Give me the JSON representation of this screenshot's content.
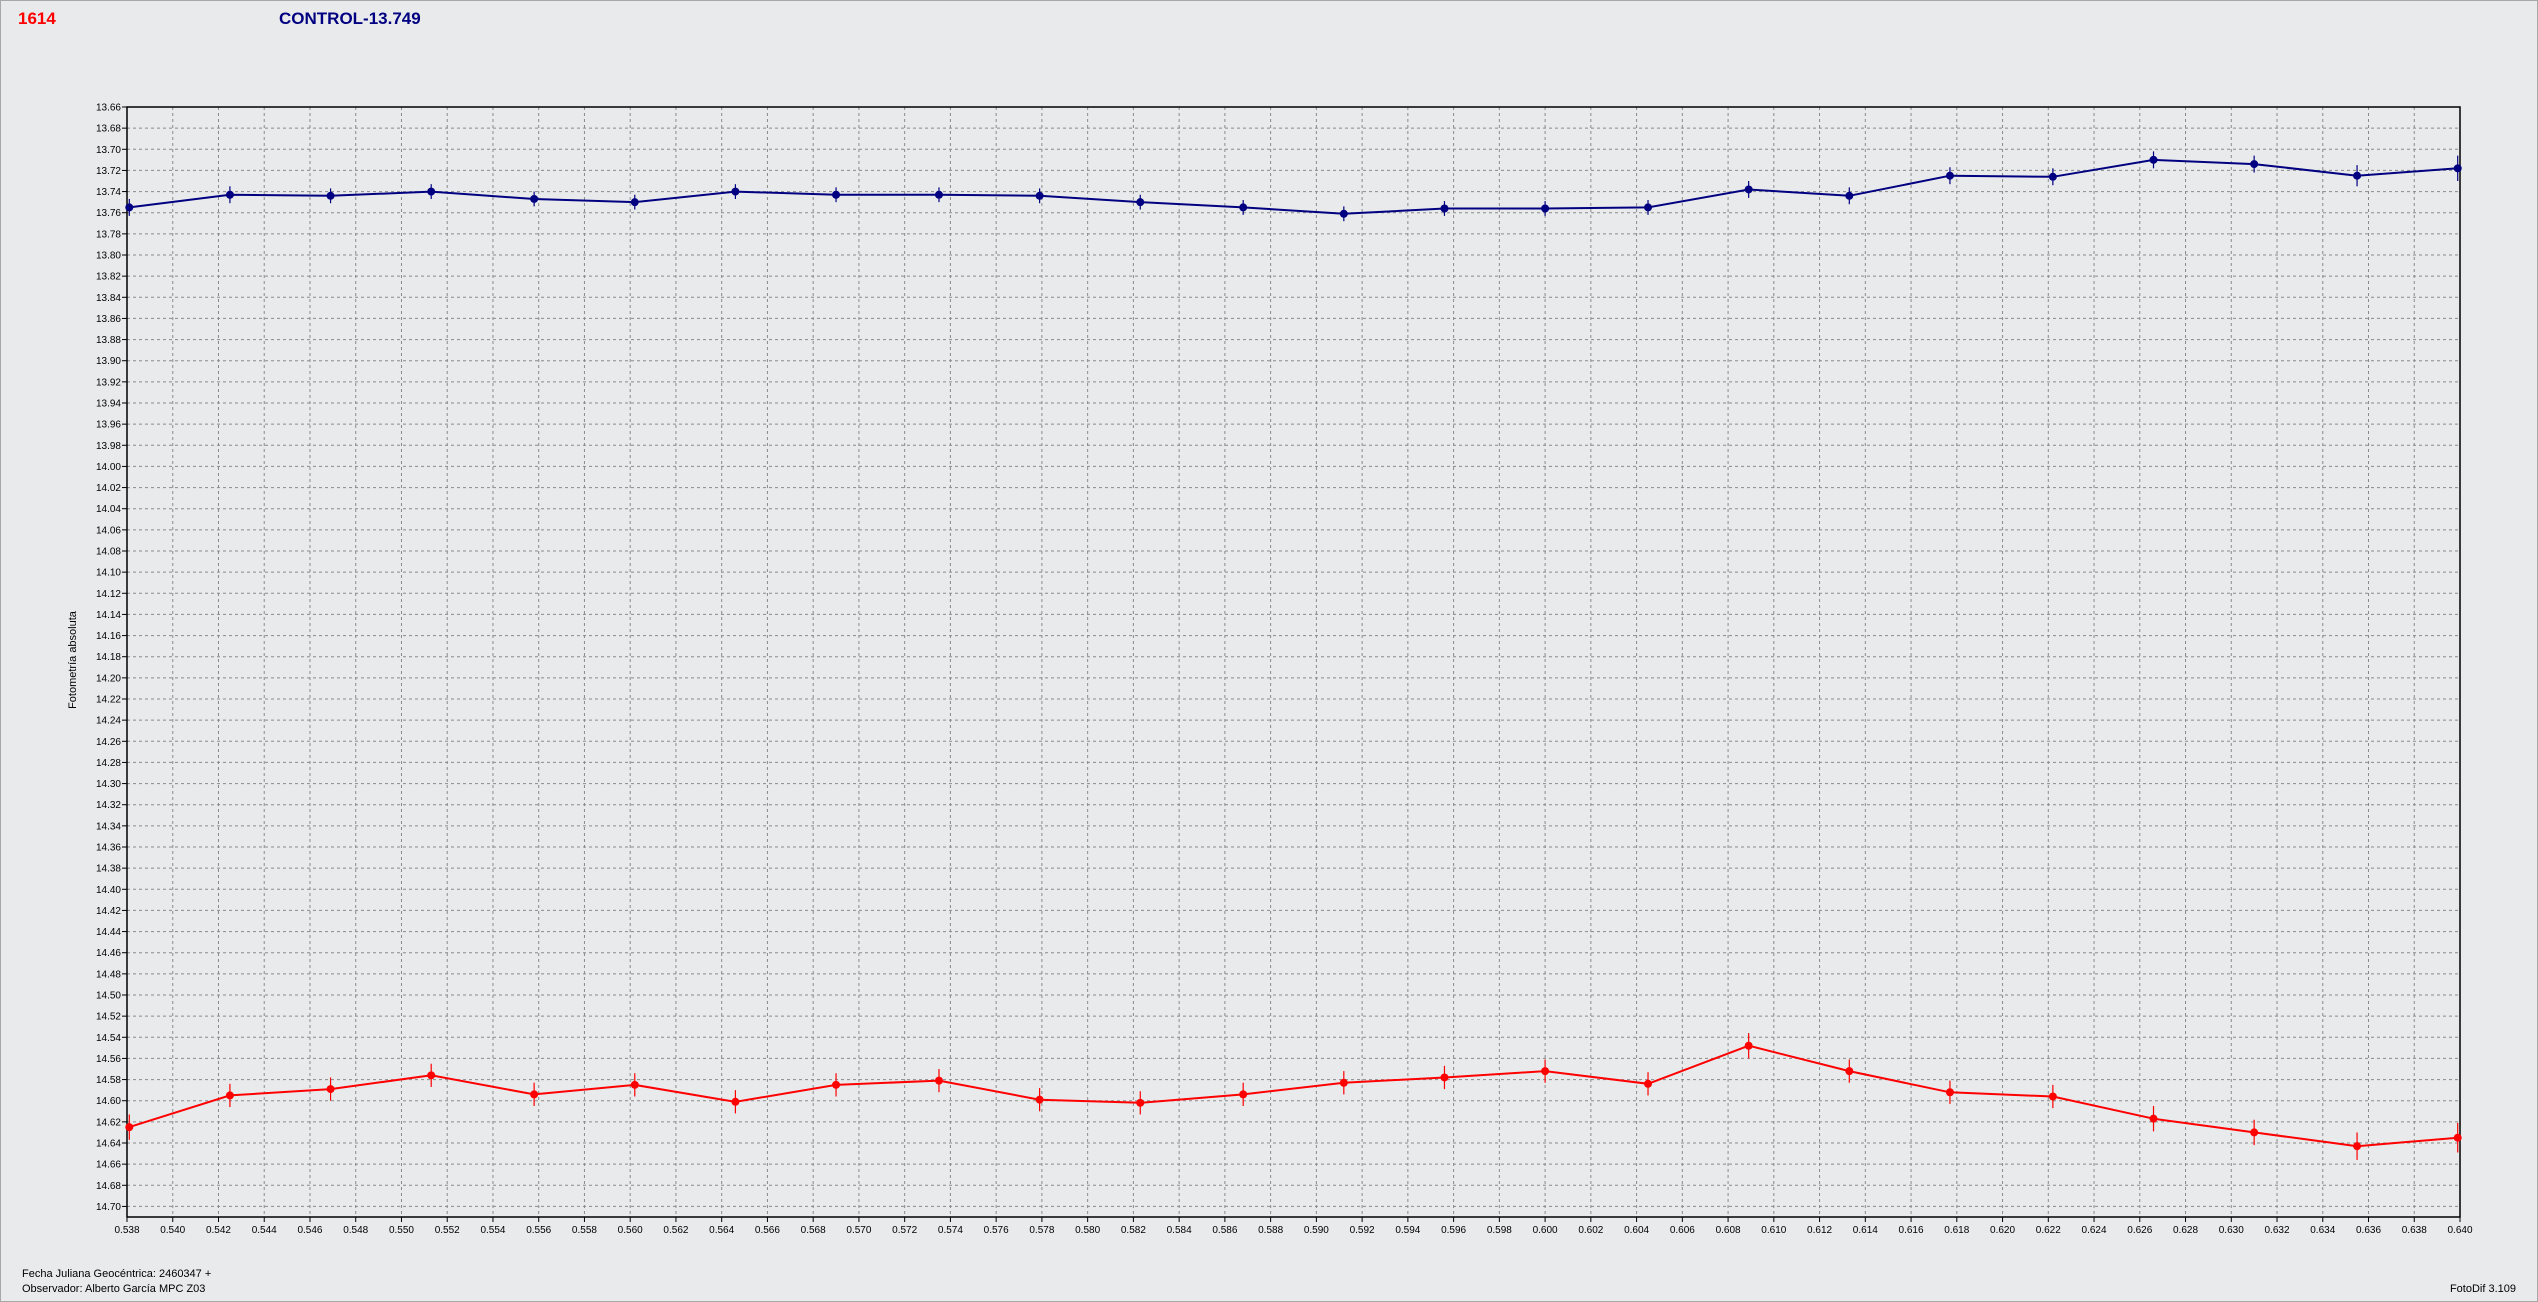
{
  "header": {
    "object_id": "1614",
    "control_label": "CONTROL-13.749"
  },
  "footer": {
    "jd_label": "Fecha Juliana Geocéntrica: 2460347 +",
    "observer_label": "Observador: Alberto García MPC Z03",
    "software_version": "FotoDif 3.109"
  },
  "chart_data": {
    "type": "line",
    "title": "",
    "xlabel": "",
    "ylabel": "Fotometría absoluta",
    "xlim": [
      0.538,
      0.64
    ],
    "ylim": [
      13.66,
      14.71
    ],
    "y_inverted": true,
    "grid": true,
    "x_ticks": [
      "0.538",
      "0.540",
      "0.542",
      "0.544",
      "0.546",
      "0.548",
      "0.550",
      "0.552",
      "0.554",
      "0.556",
      "0.558",
      "0.560",
      "0.562",
      "0.564",
      "0.566",
      "0.568",
      "0.570",
      "0.572",
      "0.574",
      "0.576",
      "0.578",
      "0.580",
      "0.582",
      "0.584",
      "0.586",
      "0.588",
      "0.590",
      "0.592",
      "0.594",
      "0.596",
      "0.598",
      "0.600",
      "0.602",
      "0.604",
      "0.606",
      "0.608",
      "0.610",
      "0.612",
      "0.614",
      "0.616",
      "0.618",
      "0.620",
      "0.622",
      "0.624",
      "0.626",
      "0.628",
      "0.630",
      "0.632",
      "0.634",
      "0.636",
      "0.638",
      "0.640"
    ],
    "y_ticks": [
      "13.66",
      "13.68",
      "13.70",
      "13.72",
      "13.74",
      "13.76",
      "13.78",
      "13.80",
      "13.82",
      "13.84",
      "13.86",
      "13.88",
      "13.90",
      "13.92",
      "13.94",
      "13.96",
      "13.98",
      "14.00",
      "14.02",
      "14.04",
      "14.06",
      "14.08",
      "14.10",
      "14.12",
      "14.14",
      "14.16",
      "14.18",
      "14.20",
      "14.22",
      "14.24",
      "14.26",
      "14.28",
      "14.30",
      "14.32",
      "14.34",
      "14.36",
      "14.38",
      "14.40",
      "14.42",
      "14.44",
      "14.46",
      "14.48",
      "14.50",
      "14.52",
      "14.54",
      "14.56",
      "14.58",
      "14.60",
      "14.62",
      "14.64",
      "14.66",
      "14.68",
      "14.70"
    ],
    "x": [
      0.5381,
      0.5425,
      0.5469,
      0.5513,
      0.5558,
      0.5602,
      0.5646,
      0.569,
      0.5735,
      0.5779,
      0.5823,
      0.5868,
      0.5912,
      0.5956,
      0.6,
      0.6045,
      0.6089,
      0.6133,
      0.6177,
      0.6222,
      0.6266,
      0.631,
      0.6355,
      0.6399
    ],
    "series": [
      {
        "color": "#000080",
        "values": [
          13.755,
          13.743,
          13.744,
          13.74,
          13.747,
          13.75,
          13.74,
          13.743,
          13.743,
          13.744,
          13.75,
          13.755,
          13.761,
          13.756,
          13.756,
          13.755,
          13.738,
          13.744,
          13.725,
          13.726,
          13.71,
          13.714,
          13.725,
          13.718
        ],
        "errors": [
          0.008,
          0.008,
          0.007,
          0.007,
          0.007,
          0.007,
          0.007,
          0.007,
          0.007,
          0.007,
          0.007,
          0.007,
          0.007,
          0.007,
          0.007,
          0.007,
          0.008,
          0.008,
          0.008,
          0.008,
          0.008,
          0.008,
          0.01,
          0.012
        ]
      },
      {
        "color": "#ff0000",
        "values": [
          14.625,
          14.595,
          14.589,
          14.576,
          14.594,
          14.585,
          14.601,
          14.585,
          14.581,
          14.599,
          14.602,
          14.594,
          14.583,
          14.578,
          14.572,
          14.584,
          14.548,
          14.572,
          14.592,
          14.596,
          14.617,
          14.63,
          14.643,
          14.635
        ],
        "errors": [
          0.012,
          0.011,
          0.011,
          0.011,
          0.011,
          0.011,
          0.011,
          0.011,
          0.011,
          0.011,
          0.011,
          0.011,
          0.011,
          0.011,
          0.011,
          0.011,
          0.012,
          0.011,
          0.011,
          0.011,
          0.012,
          0.012,
          0.013,
          0.014
        ]
      }
    ]
  }
}
